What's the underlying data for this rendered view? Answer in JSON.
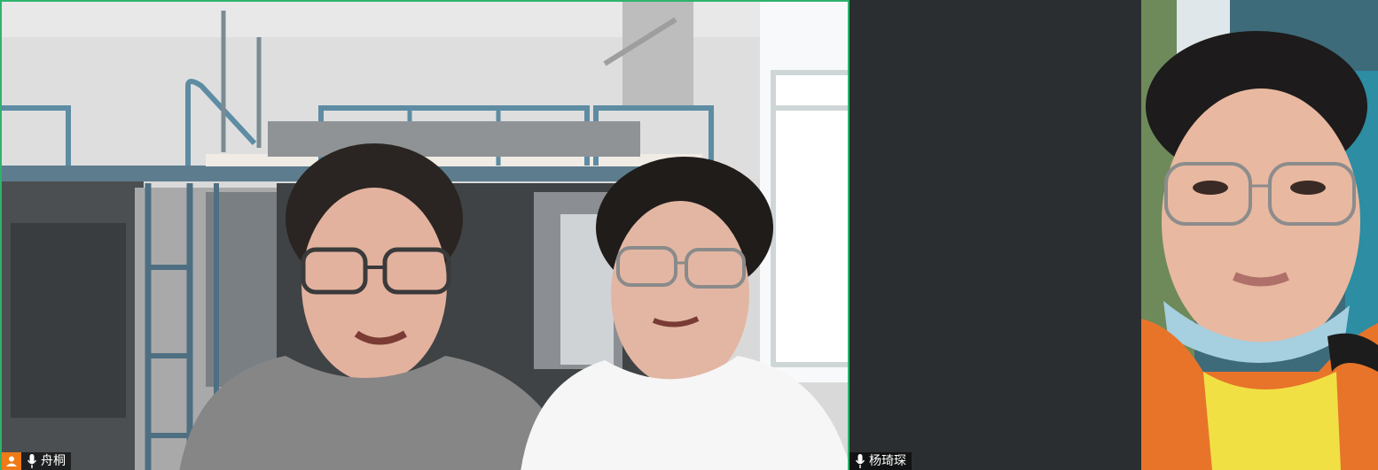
{
  "participants": [
    {
      "name": "舟桐",
      "is_host": true,
      "mic": "mic-icon"
    },
    {
      "name": "杨琦琛",
      "is_host": false,
      "mic": "mic-icon"
    },
    {
      "name": "",
      "is_host": false,
      "mic": ""
    }
  ],
  "colors": {
    "active_speaker_border": "#2fb36b",
    "host_badge": "#f07a16",
    "empty_tile": "#2b2e30",
    "nametag_bg": "rgba(0,0,0,0.6)"
  }
}
